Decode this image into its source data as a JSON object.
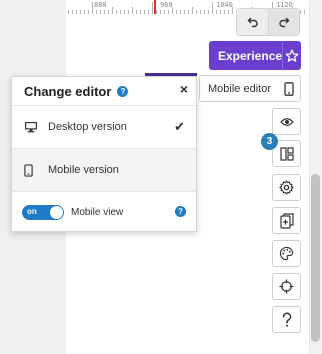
{
  "ruler": {
    "labels": [
      "880",
      "960",
      "1040",
      "1120"
    ]
  },
  "toolbar": {
    "undo_icon": "undo-icon",
    "redo_icon": "redo-icon",
    "experience_label": "Experience",
    "experience_icon": "star-icon",
    "mobile_editor_label": "Mobile editor",
    "mobile_editor_icon": "mobile-phone-icon"
  },
  "sidebar": {
    "badge_count": "3",
    "buttons": [
      "eye-icon",
      "layout-icon",
      "gear-icon",
      "pages-icon",
      "palette-icon",
      "crosshair-icon",
      "help-icon"
    ]
  },
  "change_editor": {
    "title": "Change editor",
    "close_label": "×",
    "help_glyph": "?",
    "options": [
      {
        "label": "Desktop version",
        "icon": "desktop-icon",
        "selected": true
      },
      {
        "label": "Mobile version",
        "icon": "mobile-phone-icon",
        "selected": false
      }
    ],
    "check_glyph": "✔",
    "mobile_view": {
      "label": "Mobile view",
      "toggle_state": "on"
    }
  },
  "colors": {
    "accent_purple": "#6a3fd0",
    "help_blue": "#1f7ac8",
    "badge_blue": "#2a7fb5",
    "ruler_marker": "#e32c2c"
  }
}
